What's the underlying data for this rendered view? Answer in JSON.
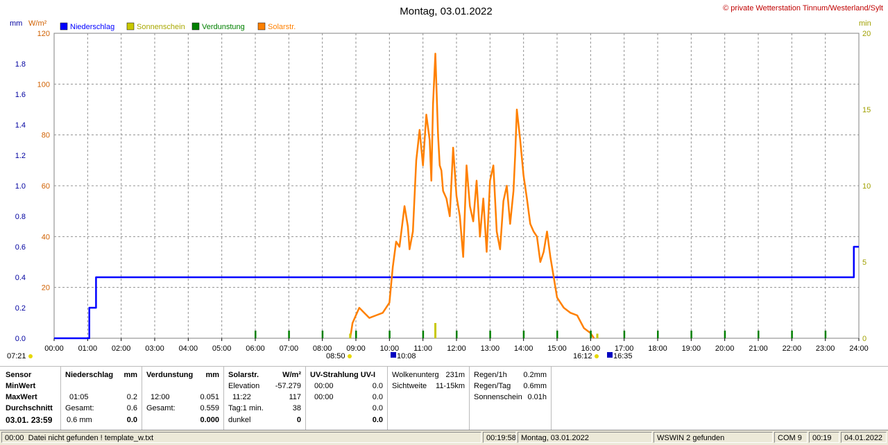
{
  "window": {
    "title": "Montag, 03.01.2022",
    "copyright": "© private Wetterstation Tinnum/Westerland/Sylt"
  },
  "chart_data": {
    "type": "line",
    "title": "Montag, 03.01.2022",
    "left_axis_unit": "mm",
    "left_axis2_unit": "W/m²",
    "right_axis_unit": "min",
    "x_ticks": [
      "00:00",
      "01:00",
      "02:00",
      "03:00",
      "04:00",
      "05:00",
      "06:00",
      "07:00",
      "08:00",
      "09:00",
      "10:00",
      "11:00",
      "12:00",
      "13:00",
      "14:00",
      "15:00",
      "16:00",
      "17:00",
      "18:00",
      "19:00",
      "20:00",
      "21:00",
      "22:00",
      "23:00",
      "24:00"
    ],
    "xlim": [
      0,
      24
    ],
    "ylim_mm": [
      0,
      2.0
    ],
    "ylim_wm2": [
      0,
      120
    ],
    "ylim_min": [
      0,
      20
    ],
    "mm_ticks": [
      "0.0",
      "0.2",
      "0.4",
      "0.6",
      "0.8",
      "1.0",
      "1.2",
      "1.4",
      "1.6",
      "1.8"
    ],
    "wm2_ticks": [
      "20",
      "40",
      "60",
      "80",
      "100",
      "120"
    ],
    "min_ticks": [
      "0",
      "5",
      "10",
      "15",
      "20"
    ],
    "grid": true,
    "legend": [
      {
        "name": "Niederschlag",
        "color": "#0000ff"
      },
      {
        "name": "Sonnenschein",
        "color": "#c8c800"
      },
      {
        "name": "Verdunstung",
        "color": "#008000"
      },
      {
        "name": "Solarstr.",
        "color": "#ff8000"
      }
    ],
    "series": [
      {
        "name": "Niederschlag",
        "axis": "mm",
        "color": "#0000ff",
        "step": true,
        "x": [
          0,
          1.0,
          1.05,
          1.2,
          1.25,
          23.8,
          23.85,
          24
        ],
        "y": [
          0,
          0,
          0.2,
          0.2,
          0.4,
          0.4,
          0.6,
          0.6
        ]
      },
      {
        "name": "Solarstr.",
        "axis": "wm2",
        "color": "#ff8000",
        "step": false,
        "x": [
          8.83,
          8.9,
          9.0,
          9.1,
          9.25,
          9.4,
          9.6,
          9.8,
          10.0,
          10.1,
          10.2,
          10.3,
          10.45,
          10.55,
          10.6,
          10.7,
          10.8,
          10.9,
          11.0,
          11.1,
          11.2,
          11.25,
          11.3,
          11.37,
          11.45,
          11.5,
          11.55,
          11.6,
          11.7,
          11.8,
          11.9,
          12.0,
          12.1,
          12.2,
          12.3,
          12.4,
          12.5,
          12.6,
          12.7,
          12.8,
          12.9,
          13.0,
          13.1,
          13.2,
          13.3,
          13.4,
          13.5,
          13.6,
          13.7,
          13.75,
          13.8,
          13.9,
          14.0,
          14.1,
          14.2,
          14.3,
          14.4,
          14.5,
          14.6,
          14.7,
          14.8,
          14.9,
          15.0,
          15.1,
          15.2,
          15.4,
          15.6,
          15.8,
          16.0,
          16.1
        ],
        "y": [
          0,
          6,
          9,
          12,
          10,
          8,
          9,
          10,
          14,
          28,
          38,
          36,
          52,
          44,
          35,
          42,
          70,
          82,
          68,
          88,
          78,
          62,
          92,
          112,
          80,
          68,
          66,
          58,
          55,
          48,
          75,
          56,
          48,
          32,
          68,
          52,
          46,
          62,
          40,
          55,
          34,
          62,
          68,
          42,
          35,
          54,
          60,
          45,
          58,
          72,
          90,
          78,
          64,
          55,
          45,
          42,
          40,
          30,
          34,
          42,
          32,
          24,
          16,
          14,
          12,
          10,
          9,
          4,
          2,
          0
        ]
      },
      {
        "name": "Sonnenschein",
        "axis": "min",
        "color": "#c8c800",
        "bars": true,
        "x": [
          8.83,
          11.37,
          16.2
        ],
        "y": [
          0.3,
          1.0,
          0.3
        ]
      },
      {
        "name": "Verdunstung",
        "axis": "min",
        "color": "#008000",
        "ticks": true,
        "x": [
          6,
          7,
          8,
          9,
          10,
          11,
          12,
          13,
          14,
          15,
          16,
          17,
          18,
          19,
          20,
          21,
          22,
          23
        ],
        "y": [
          0.5,
          0.5,
          0.5,
          0.5,
          0.5,
          0.5,
          0.5,
          0.5,
          0.5,
          0.5,
          0.5,
          0.5,
          0.5,
          0.5,
          0.5,
          0.5,
          0.5,
          0.5
        ]
      }
    ]
  },
  "sun_times": {
    "left_time": "07:21",
    "sunrise": "08:50",
    "max_time": "10:08",
    "sunset": "16:12",
    "dusk": "16:35"
  },
  "panel": {
    "sensor": {
      "head": "Sensor",
      "min": "MinWert",
      "max": "MaxWert",
      "avg": "Durchschnitt",
      "date": "03.01. 23:59"
    },
    "niederschlag": {
      "head": "Niederschlag",
      "unit": "mm",
      "max_time": "01:05",
      "max_val": "0.2",
      "gesamt_label": "Gesamt:",
      "gesamt_val": "0.6",
      "avg_text": "0.6 mm",
      "avg_val": "0.0"
    },
    "verdunstung": {
      "head": "Verdunstung",
      "unit": "mm",
      "max_time": "12:00",
      "max_val": "0.051",
      "gesamt_label": "Gesamt:",
      "gesamt_val": "0.559",
      "avg_val": "0.000"
    },
    "solar": {
      "head": "Solarstr.",
      "unit": "W/m²",
      "elev_label": "Elevation",
      "elev_val": "-57.279",
      "max_time": "11:22",
      "max_val": "117",
      "tag_label": "Tag:1 min.",
      "tag_val": "38",
      "dunkel_label": "dunkel",
      "dunkel_val": "0"
    },
    "uv": {
      "head": "UV-Strahlung UV-I",
      "r1_time": "00:00",
      "r1_val": "0.0",
      "r2_time": "00:00",
      "r2_val": "0.0",
      "r3_val": "0.0",
      "r4_val": "0.0"
    },
    "wolken": {
      "wolk_label": "Wolkenunterg",
      "wolk_val": "231m",
      "sicht_label": "Sichtweite",
      "sicht_val": "11-15km"
    },
    "regen": {
      "r1h_label": "Regen/1h",
      "r1h_val": "0.2mm",
      "rtag_label": "Regen/Tag",
      "rtag_val": "0.6mm",
      "sonne_label": "Sonnenschein",
      "sonne_val": "0.01h"
    }
  },
  "status": {
    "time": "00:00",
    "message": "Datei nicht gefunden ! template_w.txt",
    "clock": "00:19:58",
    "date": "Montag, 03.01.2022",
    "wswin": "WSWIN 2 gefunden",
    "com": "COM 9",
    "clock2": "00:19",
    "date2": "04.01.2022"
  }
}
